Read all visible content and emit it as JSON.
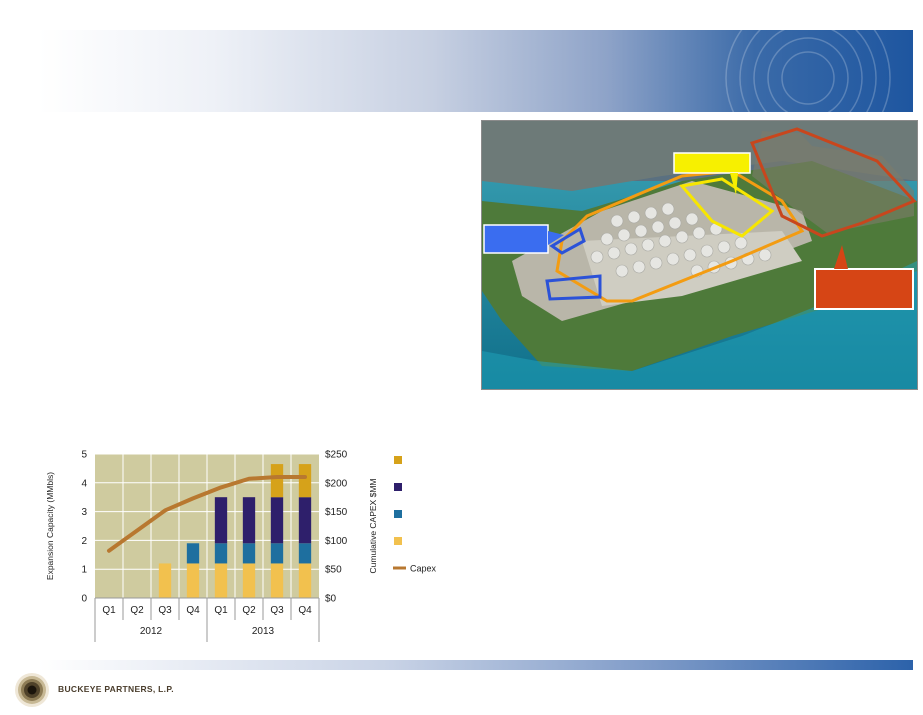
{
  "company": {
    "name": "BUCKEYE PARTNERS, L.P."
  },
  "chart_data": {
    "type": "bar",
    "categories": [
      "Q1",
      "Q2",
      "Q3",
      "Q4",
      "Q1",
      "Q2",
      "Q3",
      "Q4"
    ],
    "year_groups": [
      {
        "label": "2012",
        "span": 4
      },
      {
        "label": "2013",
        "span": 4
      }
    ],
    "ylabel": "Expansion Capacity (MMbls)",
    "y2label": "Cumulative CAPEX $MM",
    "ylim": [
      0,
      5
    ],
    "y2lim": [
      0,
      250
    ],
    "yticks": [
      "0",
      "1",
      "2",
      "3",
      "4",
      "5"
    ],
    "y2ticks": [
      "$0",
      "$50",
      "$100",
      "$150",
      "$200",
      "$250"
    ],
    "stack_series": [
      {
        "color": "#f2c14e",
        "values": [
          0,
          0,
          1.2,
          1.2,
          1.2,
          1.2,
          1.2,
          1.2
        ]
      },
      {
        "color": "#1e6f9f",
        "values": [
          0,
          0,
          0,
          0.7,
          0.7,
          0.7,
          0.7,
          0.7
        ]
      },
      {
        "color": "#2e1f6b",
        "values": [
          0,
          0,
          0,
          0,
          1.6,
          1.6,
          1.6,
          1.6
        ]
      },
      {
        "color": "#d6a21a",
        "values": [
          0,
          0,
          0,
          0,
          0,
          0,
          1.15,
          1.15
        ]
      }
    ],
    "line_series": {
      "name": "Capex",
      "color": "#b87830",
      "values": [
        82,
        117,
        152,
        173,
        192,
        207,
        210,
        210
      ]
    },
    "plot_bg": "#cfcb9f",
    "legend_position": "right"
  }
}
